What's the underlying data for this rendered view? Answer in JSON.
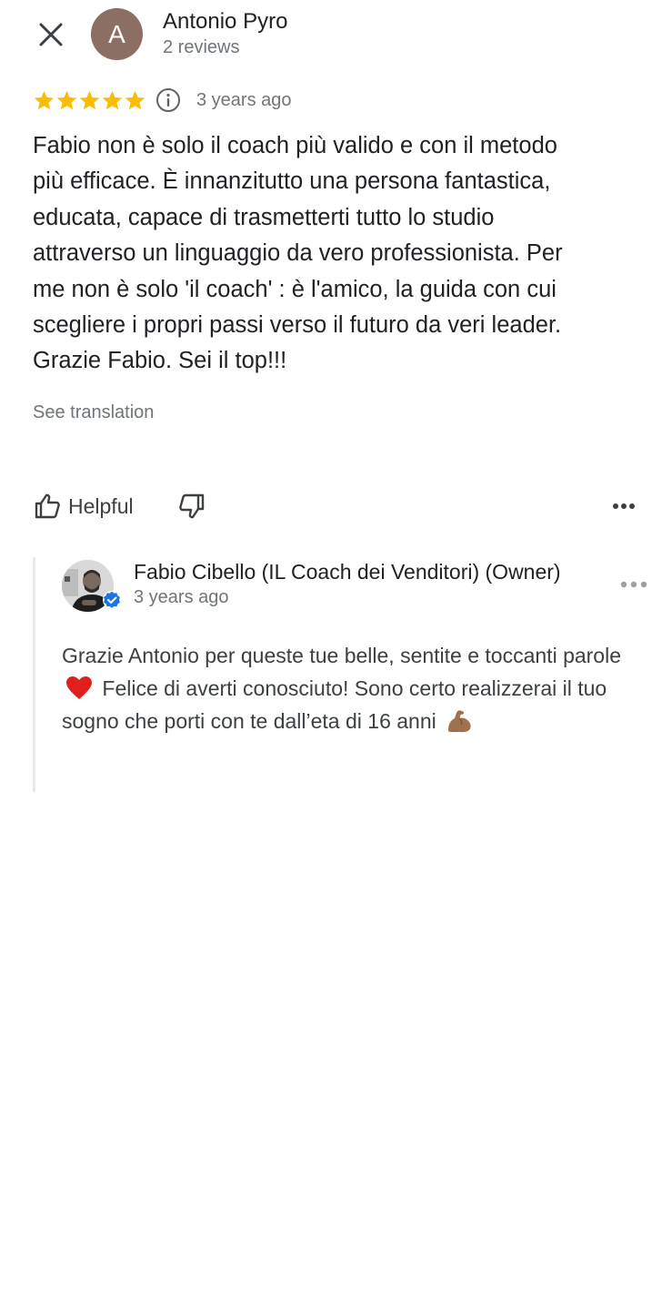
{
  "header": {
    "close_icon": "close-icon",
    "reviewer_initial": "A",
    "reviewer_avatar_color": "#8d6e63",
    "reviewer_name": "Antonio Pyro",
    "reviewer_reviews": "2 reviews"
  },
  "review": {
    "rating": 5,
    "rating_max": 5,
    "star_color": "#fbbc04",
    "date": "3 years ago",
    "text": "Fabio non è solo il coach più valido e con il metodo\npiù efficace. È innanzitutto una persona fantastica,\neducata, capace di trasmetterti tutto lo studio\nattraverso un linguaggio da vero professionista. Per\nme non è solo 'il coach' : è l'amico, la guida con cui\nscegliere i propri passi verso il futuro da veri leader.\nGrazie Fabio. Sei il top!!!",
    "see_translation": "See translation"
  },
  "actions": {
    "helpful_label": "Helpful",
    "helpful_icon": "thumb-up-icon",
    "not_helpful_icon": "thumb-down-icon",
    "more_icon": "more-horizontal-icon"
  },
  "owner_reply": {
    "name": "Fabio Cibello (IL Coach dei Venditori) (Owner)",
    "date": "3 years ago",
    "verified_color": "#1a73e8",
    "text_part1": "Grazie Antonio per queste tue belle, sentite e toccanti parole",
    "emoji1": "red-heart-emoji",
    "text_part2": "Felice di averti conosciuto! Sono certo realizzerai il tuo sogno che porti con te dall’eta di 16 anni",
    "emoji2": "flexed-biceps-emoji"
  }
}
